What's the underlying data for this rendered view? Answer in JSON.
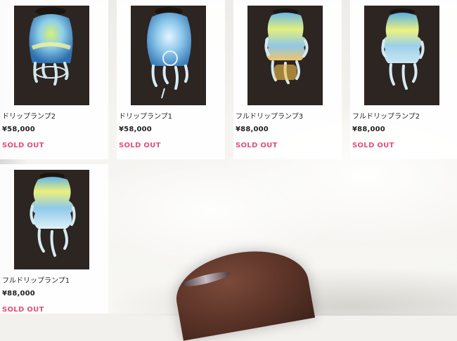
{
  "products": [
    {
      "title": "ドリップランプ2",
      "price": "¥58,000",
      "status": "SOLD OUT"
    },
    {
      "title": "ドリップランプ1",
      "price": "¥58,000",
      "status": "SOLD OUT"
    },
    {
      "title": "フルドリップランプ3",
      "price": "¥88,000",
      "status": "SOLD OUT"
    },
    {
      "title": "フルドリップランプ2",
      "price": "¥88,000",
      "status": "SOLD OUT"
    },
    {
      "title": "フルドリップランプ1",
      "price": "¥88,000",
      "status": "SOLD OUT"
    }
  ],
  "colors": {
    "sold_out": "#e0507a",
    "text": "#222222",
    "photo_bg": "#2d2521"
  }
}
